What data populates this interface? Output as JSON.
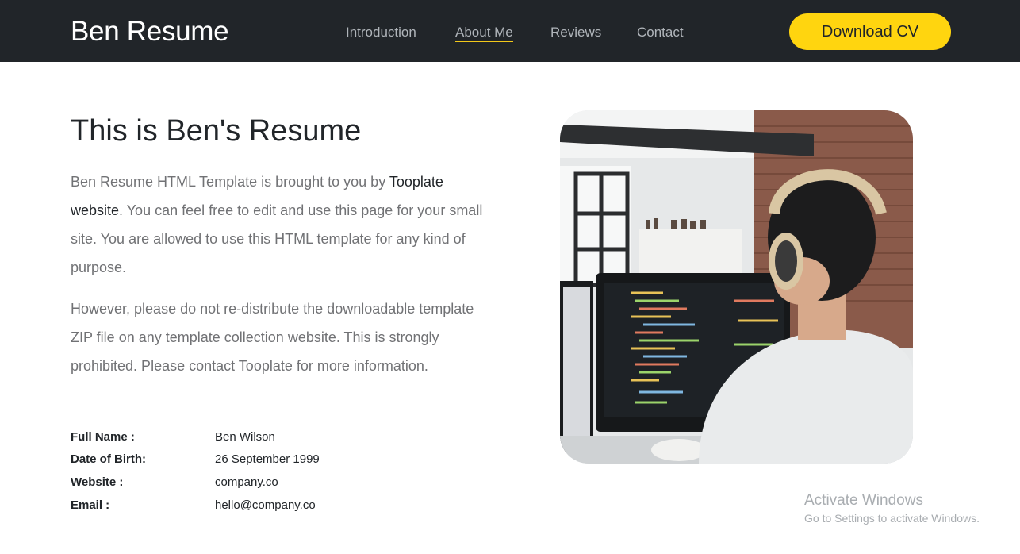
{
  "navbar": {
    "brand": "Ben Resume",
    "links": [
      {
        "label": "Introduction",
        "active": false
      },
      {
        "label": "About Me",
        "active": true
      },
      {
        "label": "Reviews",
        "active": false
      },
      {
        "label": "Contact",
        "active": false
      }
    ],
    "cta_label": "Download CV"
  },
  "about": {
    "title": "This is Ben's Resume",
    "para1_before": "Ben Resume HTML Template is brought to you by ",
    "para1_link": "Tooplate website",
    "para1_after": ". You can feel free to edit and use this page for your small site. You are allowed to use this HTML template for any kind of purpose.",
    "para2": "However, please do not re-distribute the downloadable template ZIP file on any template collection website. This is strongly prohibited. Please contact Tooplate for more information.",
    "info": {
      "name_label": "Full Name :",
      "name_value": "Ben Wilson",
      "dob_label": "Date of Birth:",
      "dob_value": "26 September 1999",
      "website_label": "Website :",
      "website_value": "company.co",
      "email_label": "Email :",
      "email_value": "hello@company.co"
    }
  },
  "watermark": {
    "title": "Activate Windows",
    "subtitle": "Go to Settings to activate Windows."
  },
  "colors": {
    "navbar_bg": "#212529",
    "accent": "#ffd50f",
    "text_muted": "#717275"
  }
}
